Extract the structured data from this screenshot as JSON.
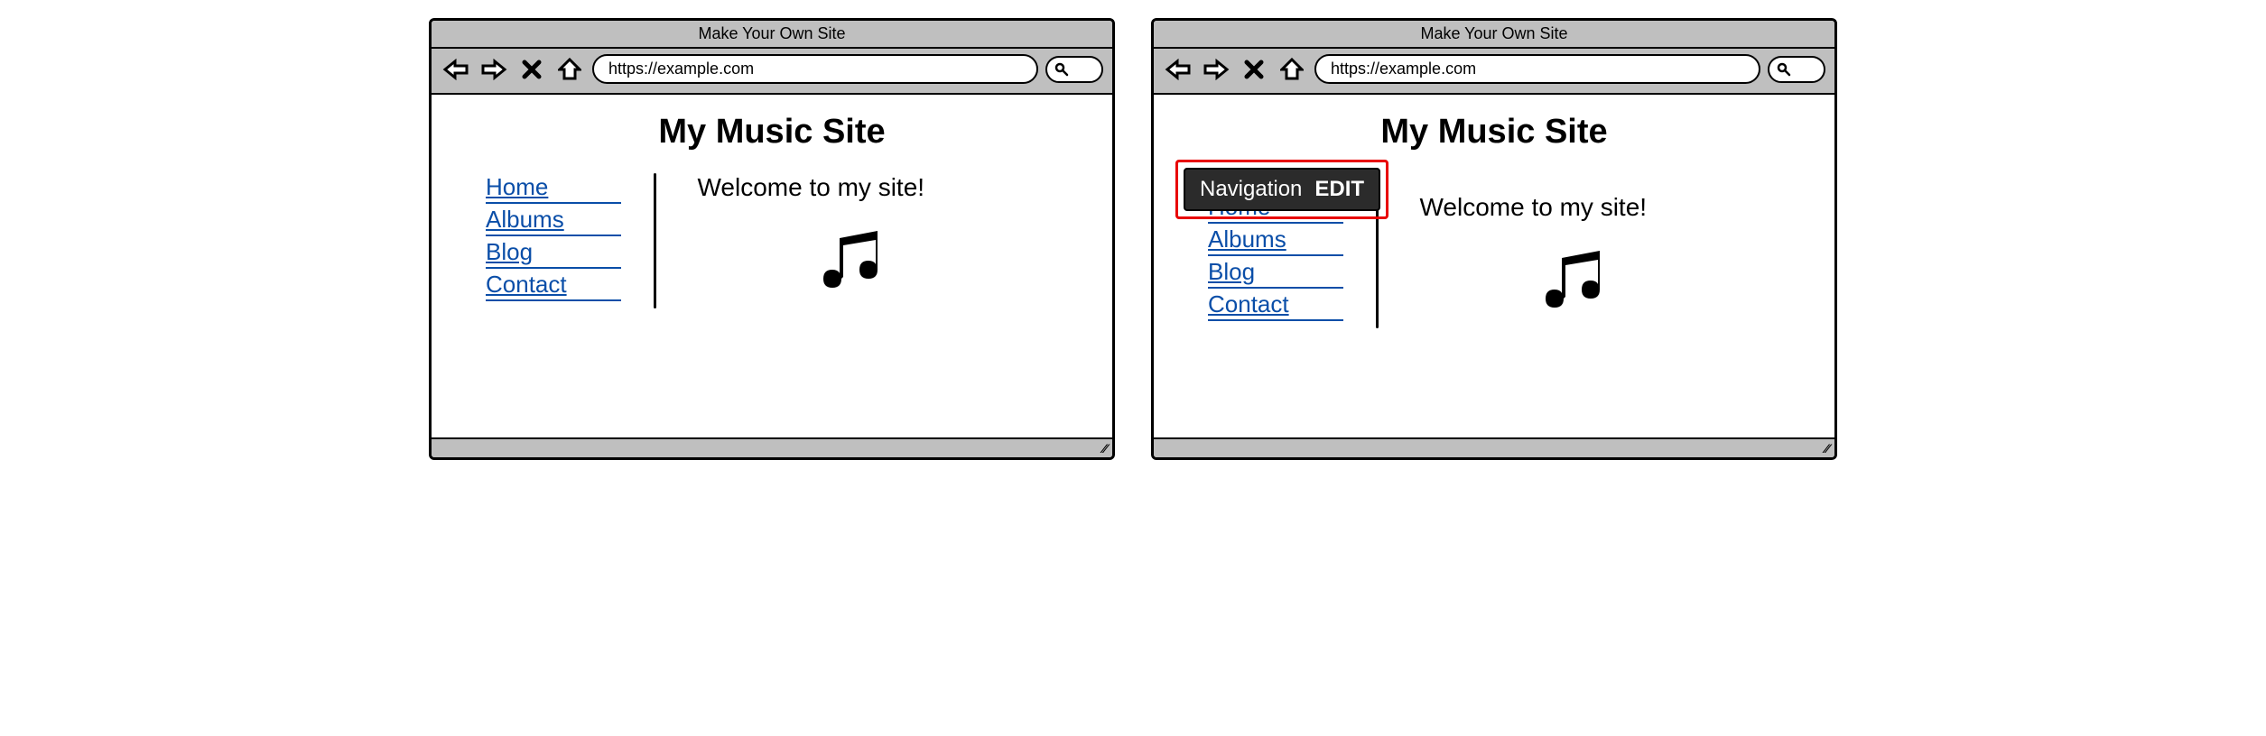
{
  "browser": {
    "title": "Make Your Own Site",
    "url": "https://example.com"
  },
  "page": {
    "heading": "My Music Site",
    "welcome": "Welcome to my site!"
  },
  "nav": {
    "items": [
      {
        "label": "Home"
      },
      {
        "label": "Albums"
      },
      {
        "label": "Blog"
      },
      {
        "label": "Contact"
      }
    ]
  },
  "annotation": {
    "label": "Navigation",
    "action": "EDIT"
  }
}
